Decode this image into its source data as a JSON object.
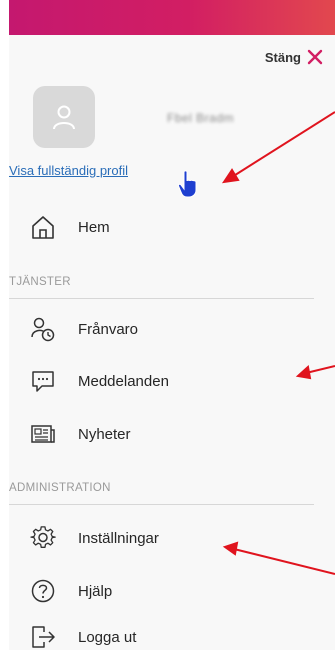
{
  "header": {
    "close_label": "Stäng"
  },
  "profile": {
    "name": "Fbel Bradm",
    "link_label": "Visa fullständig profil"
  },
  "nav": {
    "home": "Hem",
    "services_title": "TJÄNSTER",
    "absence": "Frånvaro",
    "messages": "Meddelanden",
    "news": "Nyheter",
    "admin_title": "ADMINISTRATION",
    "settings": "Inställningar",
    "help": "Hjälp",
    "logout": "Logga ut"
  },
  "colors": {
    "brand_gradient_start": "#c4186f",
    "brand_gradient_end": "#e2484e",
    "link": "#2a6db8",
    "annotation_arrow": "#e0141e"
  },
  "icons": [
    "close-icon",
    "user-icon",
    "hand-cursor-icon",
    "home-icon",
    "absence-clock-icon",
    "message-icon",
    "news-icon",
    "gear-icon",
    "help-icon",
    "logout-icon"
  ]
}
